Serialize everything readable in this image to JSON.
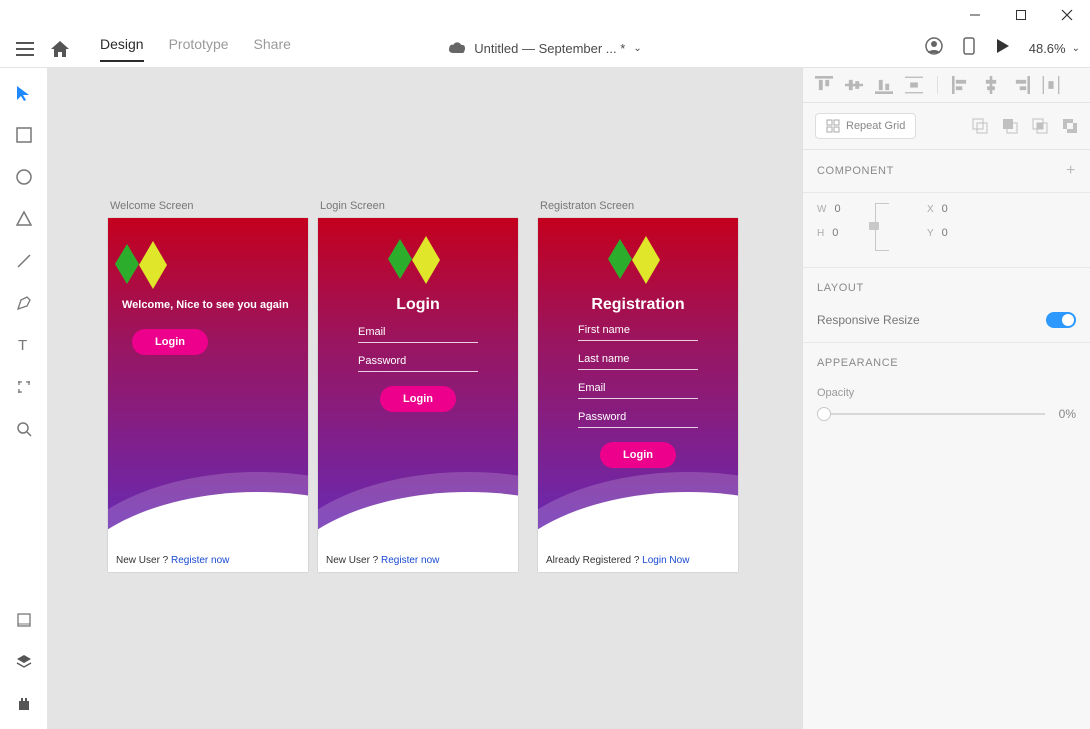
{
  "window": {
    "min": "—",
    "max": "▢",
    "close": "✕"
  },
  "doc_title": "Untitled — September ... *",
  "tabs": {
    "design": "Design",
    "prototype": "Prototype",
    "share": "Share"
  },
  "zoom": "48.6%",
  "artboards": {
    "welcome": {
      "label": "Welcome Screen",
      "message": "Welcome, Nice to see you again",
      "button": "Login",
      "footer_text": "New User ? ",
      "footer_link": "Register now"
    },
    "login": {
      "label": "Login Screen",
      "title": "Login",
      "fields": {
        "email": "Email",
        "password": "Password"
      },
      "button": "Login",
      "footer_text": "New User ? ",
      "footer_link": "Register now"
    },
    "register": {
      "label": "Registraton Screen",
      "title": "Registration",
      "fields": {
        "first": "First name",
        "last": "Last name",
        "email": "Email",
        "password": "Password"
      },
      "button": "Login",
      "footer_text": "Already  Registered ? ",
      "footer_link": "Login Now"
    }
  },
  "panel": {
    "repeat_grid": "Repeat Grid",
    "component": "COMPONENT",
    "transform": {
      "w_label": "W",
      "w": "0",
      "h_label": "H",
      "h": "0",
      "x_label": "X",
      "x": "0",
      "y_label": "Y",
      "y": "0"
    },
    "layout_title": "LAYOUT",
    "responsive": "Responsive Resize",
    "appearance_title": "APPEARANCE",
    "opacity_label": "Opacity",
    "opacity_value": "0%"
  }
}
